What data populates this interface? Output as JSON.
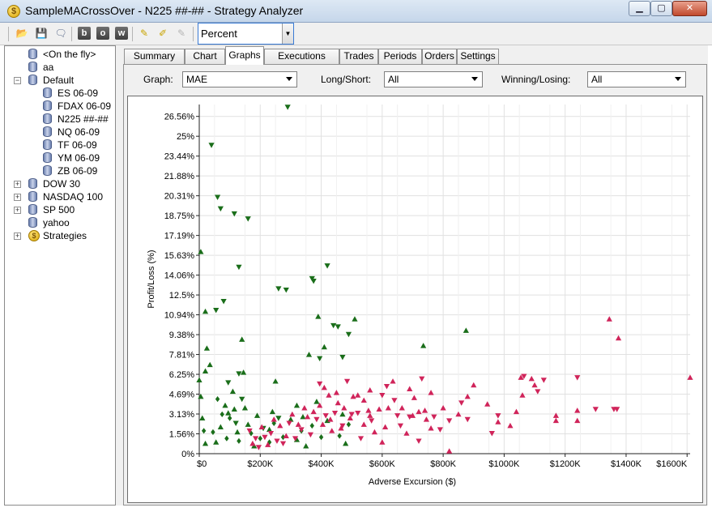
{
  "window": {
    "title": "SampleMACrossOver - N225 ##-## - Strategy Analyzer",
    "icon": "dollar-coin-icon"
  },
  "toolbar": {
    "icons": [
      "open-folder-icon",
      "save-icon",
      "comment-icon",
      "b-icon",
      "o-icon",
      "w-icon",
      "note-icon",
      "note-edit-icon",
      "note-disabled-icon"
    ],
    "letters": [
      "b",
      "o",
      "w"
    ],
    "units_value": "Percent"
  },
  "tree": {
    "items": [
      {
        "label": "<On the fly>",
        "level": 1,
        "icon": "database-icon"
      },
      {
        "label": "aa",
        "level": 1,
        "icon": "database-icon"
      },
      {
        "label": "Default",
        "level": 1,
        "icon": "database-icon",
        "expander": "−"
      },
      {
        "label": "ES 06-09",
        "level": 2,
        "icon": "database-icon"
      },
      {
        "label": "FDAX 06-09",
        "level": 2,
        "icon": "database-icon"
      },
      {
        "label": "N225 ##-##",
        "level": 2,
        "icon": "database-icon"
      },
      {
        "label": "NQ 06-09",
        "level": 2,
        "icon": "database-icon"
      },
      {
        "label": "TF 06-09",
        "level": 2,
        "icon": "database-icon"
      },
      {
        "label": "YM 06-09",
        "level": 2,
        "icon": "database-icon"
      },
      {
        "label": "ZB 06-09",
        "level": 2,
        "icon": "database-icon"
      },
      {
        "label": "DOW 30",
        "level": 1,
        "icon": "database-icon",
        "expander": "+"
      },
      {
        "label": "NASDAQ 100",
        "level": 1,
        "icon": "database-icon",
        "expander": "+"
      },
      {
        "label": "SP 500",
        "level": 1,
        "icon": "database-icon",
        "expander": "+"
      },
      {
        "label": "yahoo",
        "level": 1,
        "icon": "database-icon"
      },
      {
        "label": "Strategies",
        "level": 1,
        "icon": "dollar-coin-icon",
        "expander": "+"
      }
    ]
  },
  "tabs": [
    {
      "label": "Summary"
    },
    {
      "label": "Chart"
    },
    {
      "label": "Graphs",
      "active": true
    },
    {
      "label": "Executions"
    },
    {
      "label": "Trades"
    },
    {
      "label": "Periods"
    },
    {
      "label": "Orders"
    },
    {
      "label": "Settings"
    }
  ],
  "filters": {
    "graph_label": "Graph:",
    "graph_value": "MAE",
    "longshort_label": "Long/Short:",
    "longshort_value": "All",
    "winlose_label": "Winning/Losing:",
    "winlose_value": "All"
  },
  "chart_data": {
    "type": "scatter",
    "xlabel": "Adverse Excursion ($)",
    "ylabel": "Profit/Loss (%)",
    "xlim": [
      0,
      1610000
    ],
    "ylim": [
      0,
      27.5
    ],
    "x_ticks": [
      "$0",
      "$200K",
      "$400K",
      "$600K",
      "$800K",
      "$1000K",
      "$1200K",
      "$1400K",
      "$1600K"
    ],
    "x_tick_values": [
      0,
      200000,
      400000,
      600000,
      800000,
      1000000,
      1200000,
      1400000,
      1600000
    ],
    "y_ticks": [
      "0%",
      "1.56%",
      "3.13%",
      "4.69%",
      "6.25%",
      "7.81%",
      "9.38%",
      "10.94%",
      "12.5%",
      "14.06%",
      "15.63%",
      "17.19%",
      "18.75%",
      "20.31%",
      "21.88%",
      "23.44%",
      "25%",
      "26.56%"
    ],
    "y_tick_values": [
      0,
      1.5625,
      3.125,
      4.6875,
      6.25,
      7.8125,
      9.375,
      10.9375,
      12.5,
      14.0625,
      15.625,
      17.1875,
      18.75,
      20.3125,
      21.875,
      23.4375,
      25,
      26.5625
    ],
    "grid": true,
    "colors": {
      "winning": "#1a6e1a",
      "losing": "#d0245a"
    },
    "series": [
      {
        "name": "",
        "color": "#1a6e1a",
        "points": [
          [
            290000,
            27.3,
            "down"
          ],
          [
            40000,
            24.3,
            "down"
          ],
          [
            60000,
            20.2,
            "down"
          ],
          [
            70000,
            19.3,
            "down"
          ],
          [
            115000,
            18.9,
            "down"
          ],
          [
            160000,
            18.5,
            "down"
          ],
          [
            5000,
            15.9,
            "up"
          ],
          [
            130000,
            14.7,
            "down"
          ],
          [
            420000,
            14.8,
            "down"
          ],
          [
            370000,
            13.8,
            "down"
          ],
          [
            375000,
            13.6,
            "down"
          ],
          [
            260000,
            13.0,
            "down"
          ],
          [
            285000,
            12.9,
            "down"
          ],
          [
            80000,
            12.0,
            "down"
          ],
          [
            55000,
            11.3,
            "down"
          ],
          [
            20000,
            11.2,
            "up"
          ],
          [
            390000,
            10.8,
            "up"
          ],
          [
            510000,
            10.6,
            "up"
          ],
          [
            440000,
            10.1,
            "down"
          ],
          [
            455000,
            10.0,
            "down"
          ],
          [
            490000,
            9.4,
            "down"
          ],
          [
            875000,
            9.7,
            "up"
          ],
          [
            140000,
            9.0,
            "up"
          ],
          [
            25000,
            8.3,
            "up"
          ],
          [
            410000,
            8.4,
            "up"
          ],
          [
            735000,
            8.5,
            "up"
          ],
          [
            360000,
            7.8,
            "up"
          ],
          [
            395000,
            7.5,
            "down"
          ],
          [
            470000,
            7.6,
            "down"
          ],
          [
            35000,
            7.0,
            "up"
          ],
          [
            0,
            5.8,
            "up"
          ],
          [
            20000,
            6.5,
            "up"
          ],
          [
            130000,
            6.3,
            "down"
          ],
          [
            145000,
            6.4,
            "up"
          ],
          [
            95000,
            5.6,
            "down"
          ],
          [
            250000,
            5.7,
            "up"
          ],
          [
            5000,
            4.5,
            "up"
          ],
          [
            10000,
            2.8,
            "up"
          ],
          [
            15000,
            1.8,
            "diamond"
          ],
          [
            20000,
            0.8,
            "up"
          ],
          [
            45000,
            1.7,
            "diamond"
          ],
          [
            55000,
            0.9,
            "up"
          ],
          [
            70000,
            2.1,
            "up"
          ],
          [
            90000,
            1.2,
            "diamond"
          ],
          [
            95000,
            3.2,
            "up"
          ],
          [
            110000,
            4.9,
            "up"
          ],
          [
            120000,
            2.4,
            "down"
          ],
          [
            130000,
            1.0,
            "diamond"
          ],
          [
            140000,
            4.3,
            "down"
          ],
          [
            150000,
            3.6,
            "up"
          ],
          [
            160000,
            2.3,
            "up"
          ],
          [
            170000,
            1.6,
            "diamond"
          ],
          [
            180000,
            0.6,
            "up"
          ],
          [
            190000,
            3.0,
            "up"
          ],
          [
            200000,
            1.2,
            "diamond"
          ],
          [
            210000,
            2.0,
            "down"
          ],
          [
            230000,
            1.9,
            "up"
          ],
          [
            240000,
            3.3,
            "up"
          ],
          [
            260000,
            2.8,
            "down"
          ],
          [
            275000,
            1.3,
            "diamond"
          ],
          [
            300000,
            2.7,
            "up"
          ],
          [
            320000,
            3.8,
            "up"
          ],
          [
            335000,
            1.8,
            "diamond"
          ],
          [
            350000,
            0.6,
            "up"
          ],
          [
            370000,
            2.2,
            "diamond"
          ],
          [
            385000,
            4.1,
            "up"
          ],
          [
            400000,
            1.3,
            "diamond"
          ],
          [
            420000,
            2.6,
            "up"
          ],
          [
            460000,
            1.4,
            "diamond"
          ],
          [
            470000,
            3.1,
            "up"
          ],
          [
            480000,
            0.8,
            "up"
          ],
          [
            490000,
            2.3,
            "diamond"
          ],
          [
            60000,
            4.3,
            "diamond"
          ],
          [
            75000,
            3.1,
            "diamond"
          ],
          [
            85000,
            3.8,
            "up"
          ],
          [
            100000,
            2.8,
            "diamond"
          ],
          [
            115000,
            3.5,
            "up"
          ],
          [
            125000,
            1.7,
            "up"
          ],
          [
            230000,
            0.9,
            "diamond"
          ],
          [
            245000,
            2.4,
            "diamond"
          ],
          [
            320000,
            1.1,
            "up"
          ],
          [
            340000,
            2.9,
            "up"
          ]
        ]
      },
      {
        "name": "",
        "color": "#d0245a",
        "points": [
          [
            1610000,
            6.0,
            "up"
          ],
          [
            1345000,
            10.6,
            "up"
          ],
          [
            1375000,
            9.1,
            "up"
          ],
          [
            1240000,
            6.0,
            "down"
          ],
          [
            1240000,
            3.4,
            "up"
          ],
          [
            1240000,
            2.6,
            "up"
          ],
          [
            1300000,
            3.5,
            "down"
          ],
          [
            1360000,
            3.5,
            "down"
          ],
          [
            1370000,
            3.5,
            "down"
          ],
          [
            1170000,
            3.0,
            "up"
          ],
          [
            1170000,
            2.6,
            "up"
          ],
          [
            1130000,
            5.8,
            "down"
          ],
          [
            1100000,
            5.4,
            "up"
          ],
          [
            1110000,
            4.9,
            "down"
          ],
          [
            1090000,
            5.9,
            "up"
          ],
          [
            1065000,
            6.1,
            "down"
          ],
          [
            1055000,
            6.0,
            "up"
          ],
          [
            1060000,
            4.6,
            "up"
          ],
          [
            1040000,
            3.3,
            "up"
          ],
          [
            1020000,
            2.2,
            "up"
          ],
          [
            980000,
            3.0,
            "down"
          ],
          [
            980000,
            2.5,
            "up"
          ],
          [
            945000,
            3.9,
            "up"
          ],
          [
            960000,
            1.6,
            "down"
          ],
          [
            900000,
            5.4,
            "up"
          ],
          [
            880000,
            4.5,
            "up"
          ],
          [
            860000,
            4.0,
            "down"
          ],
          [
            850000,
            3.1,
            "up"
          ],
          [
            820000,
            2.6,
            "down"
          ],
          [
            800000,
            3.6,
            "up"
          ],
          [
            790000,
            1.9,
            "down"
          ],
          [
            770000,
            2.9,
            "down"
          ],
          [
            760000,
            4.8,
            "up"
          ],
          [
            745000,
            2.7,
            "up"
          ],
          [
            730000,
            5.9,
            "down"
          ],
          [
            720000,
            3.3,
            "up"
          ],
          [
            705000,
            4.4,
            "up"
          ],
          [
            690000,
            2.9,
            "down"
          ],
          [
            680000,
            1.6,
            "up"
          ],
          [
            665000,
            3.6,
            "up"
          ],
          [
            650000,
            3.0,
            "down"
          ],
          [
            635000,
            5.7,
            "up"
          ],
          [
            620000,
            3.6,
            "up"
          ],
          [
            610000,
            2.1,
            "up"
          ],
          [
            600000,
            4.6,
            "down"
          ],
          [
            590000,
            3.5,
            "up"
          ],
          [
            575000,
            1.7,
            "up"
          ],
          [
            565000,
            2.6,
            "down"
          ],
          [
            555000,
            3.4,
            "up"
          ],
          [
            540000,
            4.2,
            "up"
          ],
          [
            530000,
            1.2,
            "down"
          ],
          [
            520000,
            3.2,
            "down"
          ],
          [
            505000,
            4.5,
            "up"
          ],
          [
            495000,
            2.8,
            "up"
          ],
          [
            485000,
            5.7,
            "down"
          ],
          [
            475000,
            3.6,
            "up"
          ],
          [
            465000,
            2.0,
            "up"
          ],
          [
            455000,
            4.0,
            "up"
          ],
          [
            445000,
            3.2,
            "down"
          ],
          [
            435000,
            1.8,
            "up"
          ],
          [
            425000,
            4.6,
            "up"
          ],
          [
            415000,
            3.0,
            "down"
          ],
          [
            405000,
            2.3,
            "up"
          ],
          [
            395000,
            3.8,
            "up"
          ],
          [
            385000,
            2.7,
            "down"
          ],
          [
            375000,
            3.3,
            "up"
          ],
          [
            365000,
            1.5,
            "down"
          ],
          [
            355000,
            2.9,
            "up"
          ],
          [
            345000,
            3.6,
            "up"
          ],
          [
            335000,
            1.9,
            "down"
          ],
          [
            325000,
            2.3,
            "up"
          ],
          [
            315000,
            1.2,
            "down"
          ],
          [
            305000,
            3.1,
            "up"
          ],
          [
            295000,
            2.4,
            "down"
          ],
          [
            285000,
            1.4,
            "up"
          ],
          [
            275000,
            0.8,
            "down"
          ],
          [
            265000,
            2.2,
            "up"
          ],
          [
            255000,
            1.0,
            "down"
          ],
          [
            245000,
            2.7,
            "up"
          ],
          [
            235000,
            1.6,
            "down"
          ],
          [
            225000,
            0.7,
            "up"
          ],
          [
            215000,
            1.3,
            "down"
          ],
          [
            205000,
            2.1,
            "up"
          ],
          [
            195000,
            0.5,
            "down"
          ],
          [
            185000,
            1.2,
            "down"
          ],
          [
            175000,
            0.8,
            "up"
          ],
          [
            165000,
            1.8,
            "down"
          ],
          [
            600000,
            0.9,
            "up"
          ],
          [
            720000,
            1.0,
            "down"
          ],
          [
            820000,
            0.2,
            "up"
          ],
          [
            540000,
            2.3,
            "up"
          ],
          [
            660000,
            2.2,
            "down"
          ],
          [
            760000,
            2.0,
            "up"
          ],
          [
            880000,
            2.7,
            "down"
          ],
          [
            640000,
            4.2,
            "down"
          ],
          [
            700000,
            3.0,
            "up"
          ],
          [
            560000,
            5.0,
            "up"
          ],
          [
            615000,
            5.3,
            "down"
          ],
          [
            740000,
            3.4,
            "up"
          ],
          [
            690000,
            5.1,
            "up"
          ],
          [
            520000,
            4.6,
            "up"
          ],
          [
            450000,
            4.8,
            "up"
          ],
          [
            410000,
            5.2,
            "up"
          ],
          [
            395000,
            5.5,
            "down"
          ],
          [
            430000,
            2.7,
            "up"
          ],
          [
            470000,
            2.2,
            "down"
          ],
          [
            500000,
            3.1,
            "down"
          ],
          [
            560000,
            3.0,
            "up"
          ]
        ]
      }
    ]
  }
}
